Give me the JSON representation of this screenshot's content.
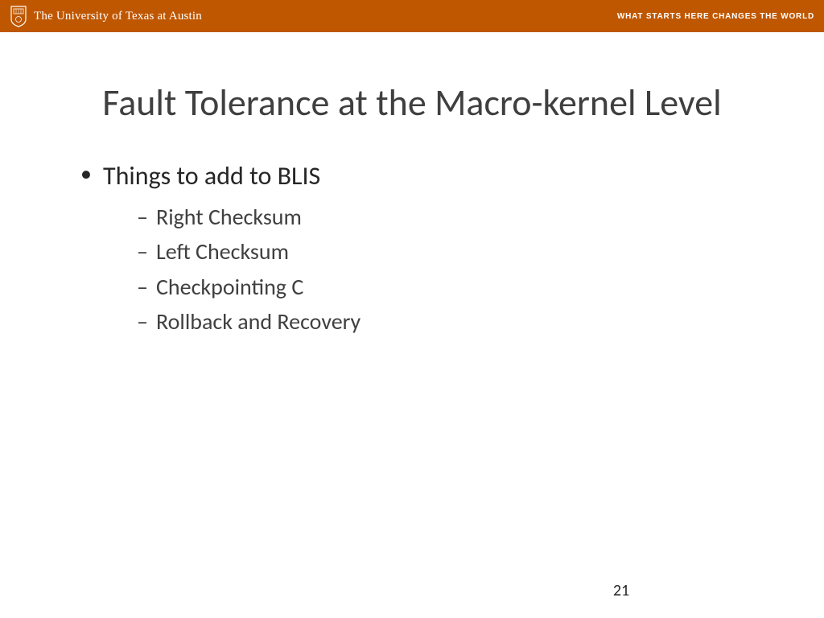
{
  "header": {
    "institution": "The University of Texas at Austin",
    "tagline": "WHAT STARTS HERE CHANGES THE WORLD"
  },
  "slide": {
    "title": "Fault Tolerance at the Macro-kernel Level",
    "bullets": [
      {
        "text": "Things to add to BLIS",
        "sub": [
          "Right Checksum",
          "Left Checksum",
          "Checkpointing C",
          "Rollback and Recovery"
        ]
      }
    ],
    "page_number": "21"
  }
}
